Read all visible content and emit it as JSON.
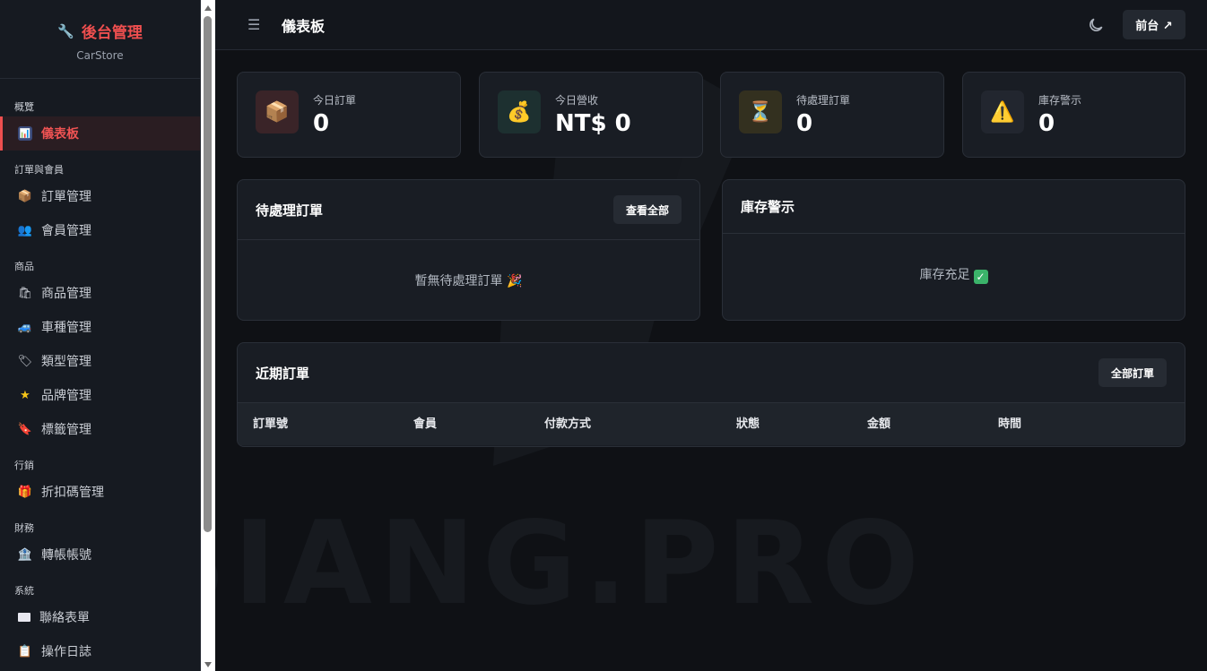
{
  "sidebar": {
    "brand_title": "後台管理",
    "brand_sub": "CarStore",
    "sections": {
      "overview": "概覽",
      "orders_members": "訂單與會員",
      "products": "商品",
      "marketing": "行銷",
      "finance": "財務",
      "system": "系統"
    },
    "items": {
      "dashboard": "儀表板",
      "orders": "訂單管理",
      "members": "會員管理",
      "products": "商品管理",
      "car_models": "車種管理",
      "categories": "類型管理",
      "brands": "品牌管理",
      "tags": "標籤管理",
      "coupons": "折扣碼管理",
      "bank_accounts": "轉帳帳號",
      "contact_forms": "聯絡表單",
      "logs": "操作日誌"
    },
    "icons": {
      "brand": "wrench-icon",
      "dashboard": "bar-chart-icon",
      "orders": "package-icon",
      "members": "people-icon",
      "products": "shopping-bags-icon",
      "car_models": "car-icon",
      "categories": "label-icon",
      "brands": "star-icon",
      "tags": "tag-icon",
      "coupons": "gift-icon",
      "bank_accounts": "bank-icon",
      "contact_forms": "envelope-icon",
      "logs": "clipboard-icon"
    },
    "active_item": "dashboard"
  },
  "topbar": {
    "title": "儀表板",
    "front_button": "前台 ↗"
  },
  "stats": [
    {
      "label": "今日訂單",
      "value": "0",
      "icon": "package-icon"
    },
    {
      "label": "今日營收",
      "value": "NT$ 0",
      "icon": "money-bag-icon"
    },
    {
      "label": "待處理訂單",
      "value": "0",
      "icon": "hourglass-icon"
    },
    {
      "label": "庫存警示",
      "value": "0",
      "icon": "warning-icon"
    }
  ],
  "pending_panel": {
    "title": "待處理訂單",
    "button": "查看全部",
    "empty_text": "暫無待處理訂單 🎉"
  },
  "stock_panel": {
    "title": "庫存警示",
    "empty_text": "庫存充足"
  },
  "recent_panel": {
    "title": "近期訂單",
    "button": "全部訂單",
    "columns": [
      "訂單號",
      "會員",
      "付款方式",
      "狀態",
      "金額",
      "時間"
    ]
  },
  "watermark": "SIANG.PRO",
  "colors": {
    "accent": "#ef4f4f",
    "background": "#0f1115",
    "card": "#191d24",
    "sidebar": "#161a21"
  }
}
